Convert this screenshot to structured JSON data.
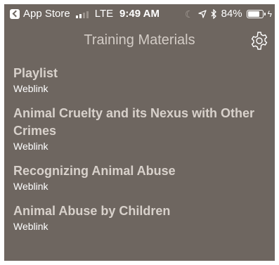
{
  "status_bar": {
    "back_app": "App Store",
    "network": "LTE",
    "time": "9:49 AM",
    "battery": "84%",
    "battery_level": 0.84,
    "signal_bars": 2
  },
  "nav": {
    "title": "Training Materials",
    "settings_icon": "gear-icon"
  },
  "items": [
    {
      "title": "Playlist",
      "subtitle": "Weblink"
    },
    {
      "title": "Animal Cruelty and its Nexus with Other Crimes",
      "subtitle": "Weblink"
    },
    {
      "title": "Recognizing Animal Abuse",
      "subtitle": "Weblink"
    },
    {
      "title": "Animal Abuse by Children",
      "subtitle": "Weblink"
    }
  ],
  "colors": {
    "background": "#6e6660",
    "title_text": "#d8d1cb",
    "subtitle_text": "#ffffff"
  }
}
